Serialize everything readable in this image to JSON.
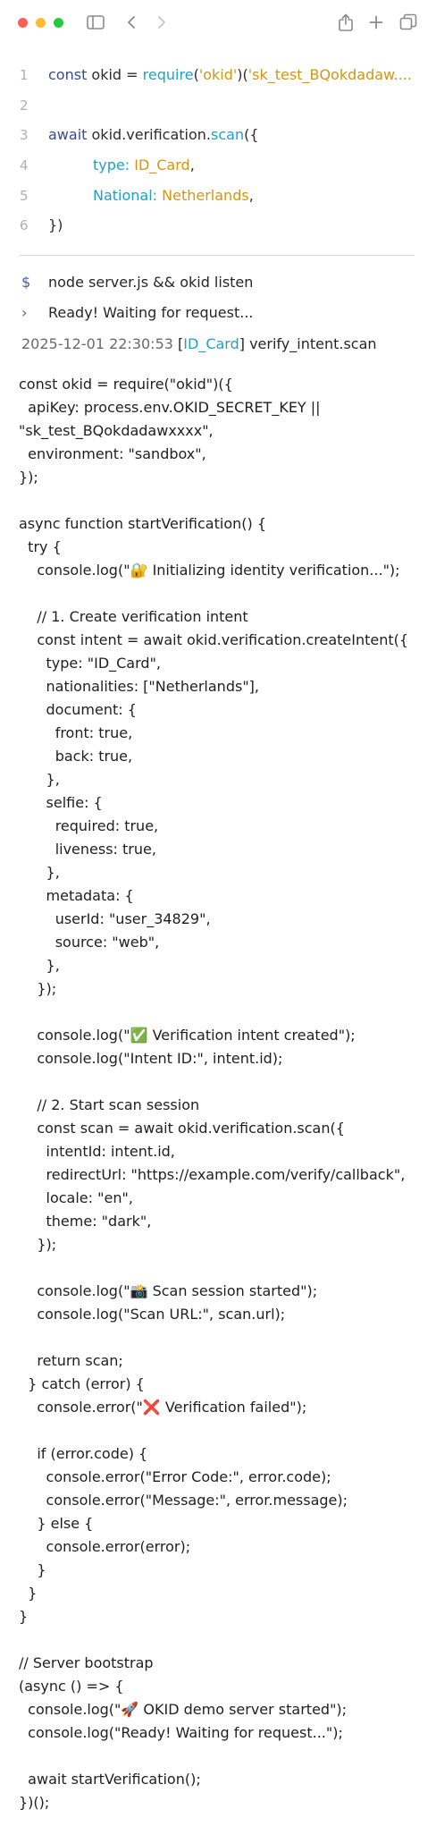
{
  "window": {
    "traffic_lights": {
      "close": "#ff5f57",
      "minimize": "#febc2e",
      "zoom": "#28c840"
    },
    "icons": [
      "sidebar-icon",
      "chevron-left-icon",
      "chevron-right-icon",
      "share-icon",
      "plus-icon",
      "tabs-icon"
    ]
  },
  "snippet": {
    "line_numbers": [
      "1",
      "2",
      "3",
      "4",
      "5",
      "6"
    ],
    "l1": {
      "kw": "const",
      "var": " okid = ",
      "fn": "require",
      "a": "(",
      "s1": "'okid'",
      "b": ")(",
      "s2": "'sk_test_BQokdadaw...."
    },
    "l3": {
      "kw": "await",
      "obj": " okid.verification.",
      "fn": "scan",
      "rest": "({"
    },
    "l4": {
      "key": "type: ",
      "val": "ID_Card",
      "end": ","
    },
    "l5": {
      "key": "National: ",
      "val": "Netherlands",
      "end": ","
    },
    "l6": "})"
  },
  "terminal": {
    "prompt": "$",
    "command": "node server.js && okid listen",
    "ready_caret": "›",
    "ready_text": "Ready! Waiting for request...",
    "log": {
      "timestamp": "2025-12-01  22:30:53",
      "open": "[",
      "tag": "ID_Card",
      "close": "]",
      "msg": " verify_intent.scan"
    }
  },
  "source_code": "const okid = require(\"okid\")({\n  apiKey: process.env.OKID_SECRET_KEY ||\n\"sk_test_BQokdadawxxxx\",\n  environment: \"sandbox\",\n});\n\nasync function startVerification() {\n  try {\n    console.log(\"🔐 Initializing identity verification...\");\n\n    // 1. Create verification intent\n    const intent = await okid.verification.createIntent({\n      type: \"ID_Card\",\n      nationalities: [\"Netherlands\"],\n      document: {\n        front: true,\n        back: true,\n      },\n      selfie: {\n        required: true,\n        liveness: true,\n      },\n      metadata: {\n        userId: \"user_34829\",\n        source: \"web\",\n      },\n    });\n\n    console.log(\"✅ Verification intent created\");\n    console.log(\"Intent ID:\", intent.id);\n\n    // 2. Start scan session\n    const scan = await okid.verification.scan({\n      intentId: intent.id,\n      redirectUrl: \"https://example.com/verify/callback\",\n      locale: \"en\",\n      theme: \"dark\",\n    });\n\n    console.log(\"📸 Scan session started\");\n    console.log(\"Scan URL:\", scan.url);\n\n    return scan;\n  } catch (error) {\n    console.error(\"❌ Verification failed\");\n\n    if (error.code) {\n      console.error(\"Error Code:\", error.code);\n      console.error(\"Message:\", error.message);\n    } else {\n      console.error(error);\n    }\n  }\n}\n\n// Server bootstrap\n(async () => {\n  console.log(\"🚀 OKID demo server started\");\n  console.log(\"Ready! Waiting for request...\");\n\n  await startVerification();\n})();"
}
